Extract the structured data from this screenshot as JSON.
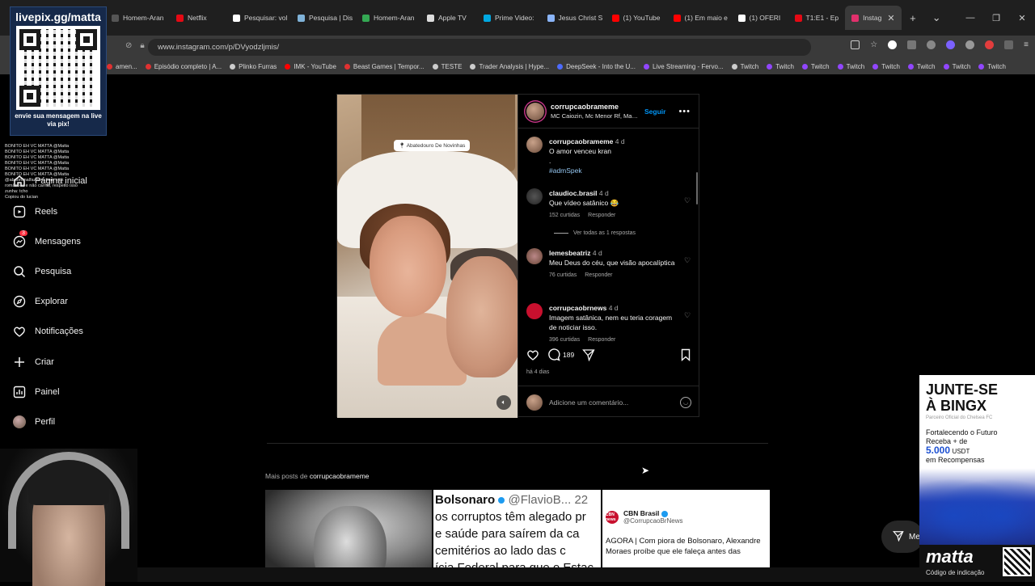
{
  "browser": {
    "tabs": [
      {
        "label": "Homem-Aran",
        "color": "#555555"
      },
      {
        "label": "Netflix",
        "color": "#e50914"
      },
      {
        "label": "Pesquisar: vol",
        "color": "#ffffff"
      },
      {
        "label": "Pesquisa | Dis",
        "color": "#7fb2d8"
      },
      {
        "label": "Homem-Aran",
        "color": "#34a853"
      },
      {
        "label": "Apple TV",
        "color": "#dddddd"
      },
      {
        "label": "Prime Video:",
        "color": "#00a8e1"
      },
      {
        "label": "Jesus Christ S",
        "color": "#8ab4f8"
      },
      {
        "label": "(1) YouTube",
        "color": "#ff0000"
      },
      {
        "label": "(1) Em maio e",
        "color": "#ff0000"
      },
      {
        "label": "(1) OFERI",
        "color": "#ffffff"
      },
      {
        "label": "T1:E1 - Ep",
        "color": "#e50914"
      },
      {
        "label": "Instag",
        "color": "#e1306c"
      }
    ],
    "url": "www.instagram.com/p/DVyodzljmis/",
    "bookmarks": [
      {
        "label": "amen...",
        "color": "#e03131"
      },
      {
        "label": "Episódio completo | A...",
        "color": "#e03131"
      },
      {
        "label": "Plinko Furras",
        "color": "#cccccc"
      },
      {
        "label": "IMK - YouTube",
        "color": "#ff0000"
      },
      {
        "label": "Beast Games | Tempor...",
        "color": "#e03131"
      },
      {
        "label": "TESTE",
        "color": "#cccccc"
      },
      {
        "label": "Trader Analysis | Hype...",
        "color": "#cccccc"
      },
      {
        "label": "DeepSeek - Into the U...",
        "color": "#4d6bfe"
      },
      {
        "label": "Live Streaming - Fervo...",
        "color": "#9146ff"
      },
      {
        "label": "Twitch",
        "color": "#cccccc"
      },
      {
        "label": "Twitch",
        "color": "#9146ff"
      },
      {
        "label": "Twitch",
        "color": "#9146ff"
      },
      {
        "label": "Twitch",
        "color": "#9146ff"
      },
      {
        "label": "Twitch",
        "color": "#9146ff"
      },
      {
        "label": "Twitch",
        "color": "#9146ff"
      },
      {
        "label": "Twitch",
        "color": "#9146ff"
      },
      {
        "label": "Twitch",
        "color": "#9146ff"
      }
    ]
  },
  "nav": {
    "home": "Página inicial",
    "reels": "Reels",
    "messages": "Mensagens",
    "messages_badge": "3",
    "search": "Pesquisa",
    "explore": "Explorar",
    "notifications": "Notificações",
    "create": "Criar",
    "dashboard": "Painel",
    "profile": "Perfil"
  },
  "post": {
    "username": "corrupcaobrameme",
    "audio": "MC Caiozin, Mc Menor Rf, Marvin...",
    "follow": "Seguir",
    "sticker": "Abatedouro De Novinhas",
    "comments": [
      {
        "user": "corrupcaobrameme",
        "time": "4 d",
        "text": "O amor venceu kran",
        "extra": ".",
        "hashtag": "#admSpek"
      },
      {
        "user": "claudioc.brasil",
        "time": "4 d",
        "text": "Que vídeo satânico 😂",
        "likes": "152 curtidas",
        "reply": "Responder",
        "view_replies": "Ver todas as 1 respostas"
      },
      {
        "user": "lemesbeatriz",
        "time": "4 d",
        "text": "Meu Deus do céu, que visão apocalíptica",
        "likes": "76 curtidas",
        "reply": "Responder"
      },
      {
        "user": "corrupcaobrnews",
        "time": "4 d",
        "text": "Imagem satânica, nem eu teria coragem de noticiar isso.",
        "likes": "396 curtidas",
        "reply": "Responder"
      }
    ],
    "comment_count": "189",
    "date": "há 4 dias",
    "add_comment_placeholder": "Adicione um comentário..."
  },
  "more_posts": {
    "prefix": "Mais posts de",
    "user": "corrupcaobrameme",
    "tweet": {
      "name": "Bolsonaro",
      "handle": "@FlavioB...",
      "num": "22",
      "lines": [
        "os corruptos têm alegado pr",
        "e saúde para saírem da ca",
        "cemitérios ao lado das c",
        "ícia Federal para que o Estac"
      ]
    },
    "cbn": {
      "name": "CBN Brasil",
      "handle": "@CorrupcaoBrNews",
      "logo": "CBN news",
      "text": "AGORA | Com piora de Bolsonaro, Alexandre Moraes proíbe que ele faleça antes das"
    }
  },
  "overlay": {
    "qr_title": "livepix.gg/matta",
    "qr_caption": "envie sua mensagem na live via pix!",
    "chat_lines": [
      "BONITO EH VC MATTA @Matta",
      "BONITO EH VC MATTA @Matta",
      "BONITO EH VC MATTA @Matta",
      "BONITO EH VC MATTA @Matta",
      "BONITO EH VC MATTA @Matta",
      "BONITO EH VC MATTA @Matta",
      "@abdominalfazbem bom nick",
      "romântico e não carnal, respeito isso",
      "zunha: tcho",
      "Copiou do lucian"
    ],
    "ad": {
      "title_1": "JUNTE-SE",
      "title_2": "À BINGX",
      "sub": "Parceiro Oficial do Chelsea FC",
      "line1": "Fortalecendo o Futuro",
      "line2": "Receba + de",
      "amount": "5.000",
      "currency": "USDT",
      "line3": "em Recompensas"
    },
    "brand": "matta",
    "brand_code": "Código de indicação",
    "messages_pill": "Me"
  }
}
